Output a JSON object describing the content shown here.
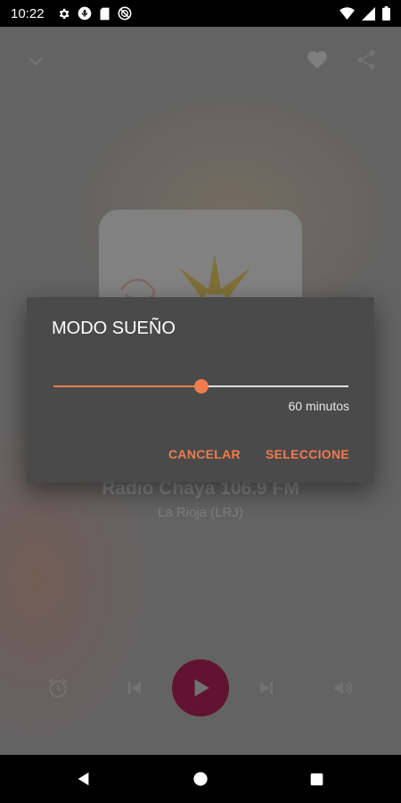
{
  "status_bar": {
    "time": "10:22",
    "left_icons": [
      "settings-icon",
      "mic-icon",
      "sd-card-icon",
      "sync-blocked-icon"
    ],
    "right_icons": [
      "wifi-icon",
      "signal-icon",
      "battery-icon"
    ]
  },
  "player": {
    "station_name": "Radio Chaya 106.9 FM",
    "station_location": "La Rioja (LRJ)",
    "top_icons": [
      "chevron-down-icon",
      "heart-icon",
      "share-icon"
    ],
    "control_icons": [
      "alarm-icon",
      "skip-previous-icon",
      "play-icon",
      "skip-next-icon",
      "volume-icon"
    ],
    "play_button_color": "#6a1533"
  },
  "dialog": {
    "title": "MODO SUEÑO",
    "slider_fraction": 0.5,
    "slider_value_text": "60 minutos",
    "cancel_label": "CANCELAR",
    "confirm_label": "SELECCIONE",
    "accent_color": "#f07b4c"
  },
  "nav_bar": {
    "icons": [
      "back-icon",
      "home-icon",
      "recents-icon"
    ]
  }
}
